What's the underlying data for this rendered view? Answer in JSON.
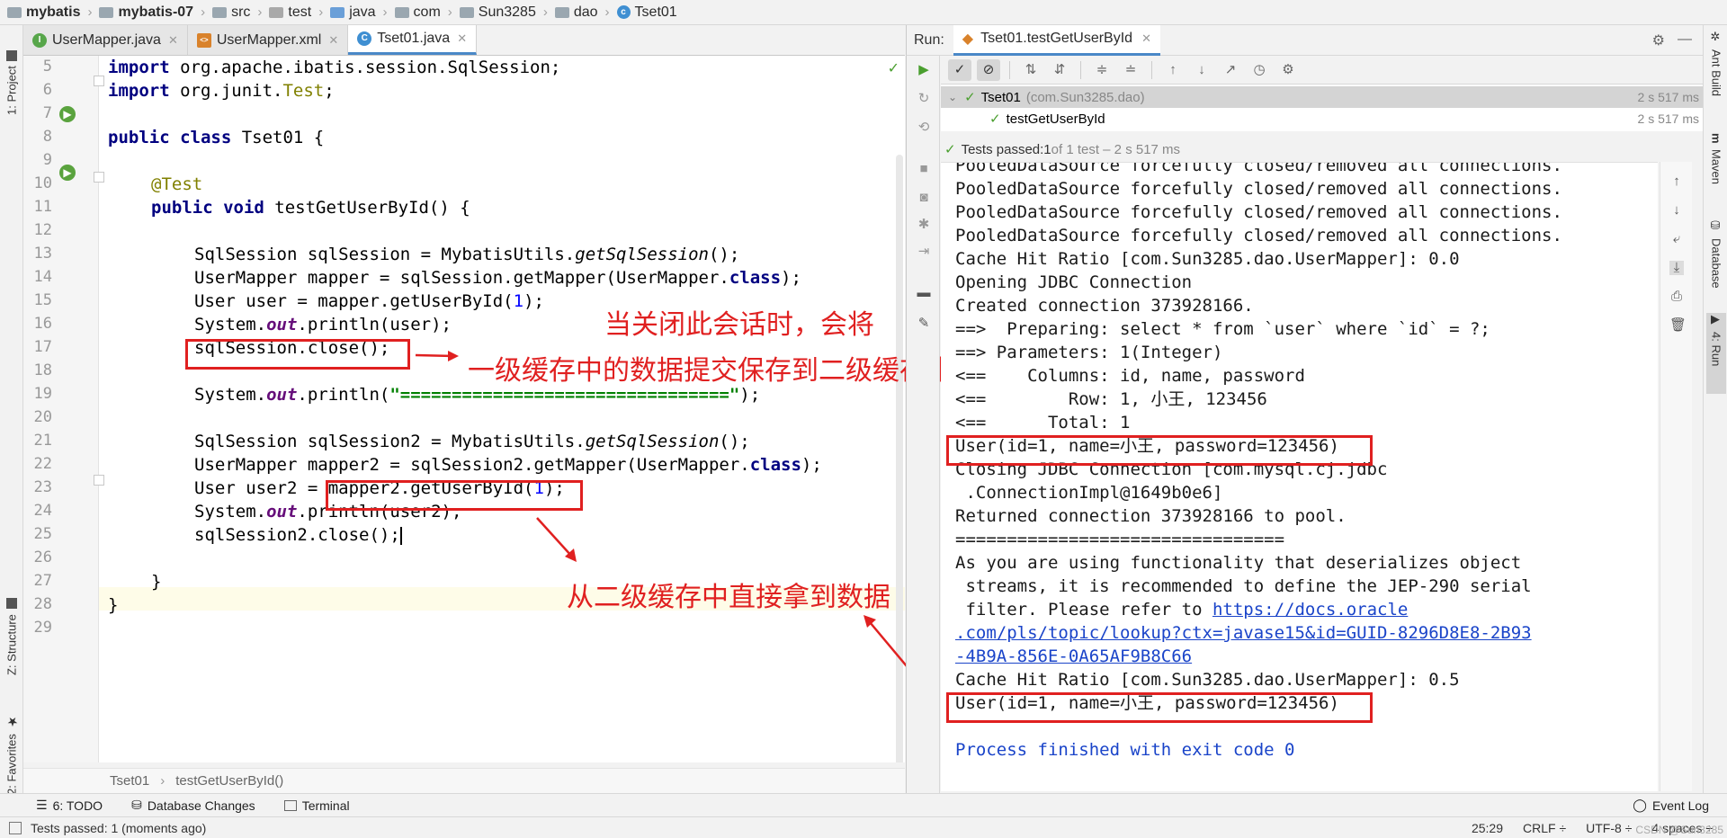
{
  "breadcrumb": [
    "mybatis",
    "mybatis-07",
    "src",
    "test",
    "java",
    "com",
    "Sun3285",
    "dao",
    "Tset01"
  ],
  "left_stripe": {
    "project": "1: Project",
    "structure": "Z: Structure",
    "favorites": "2: Favorites"
  },
  "editor_tabs": [
    {
      "label": "UserMapper.java",
      "icon": "I"
    },
    {
      "label": "UserMapper.xml",
      "icon": "<>"
    },
    {
      "label": "Tset01.java",
      "icon": "C"
    }
  ],
  "code": {
    "line_numbers": [
      "5",
      "6",
      "7",
      "8",
      "9",
      "10",
      "11",
      "12",
      "13",
      "14",
      "15",
      "16",
      "17",
      "18",
      "19",
      "20",
      "21",
      "22",
      "23",
      "24",
      "25",
      "26",
      "27",
      "28",
      "29"
    ],
    "l5": {
      "kw": "import",
      "rest": " org.apache.ibatis.session.SqlSession;"
    },
    "l6": {
      "kw": "import",
      "a": " org.junit.",
      "cls": "Test",
      "b": ";"
    },
    "l8": {
      "kw1": "public",
      "kw2": "class",
      "name": " Tset01 {"
    },
    "l10": {
      "ann": "@Test"
    },
    "l11": {
      "kw1": "public",
      "kw2": "void",
      "rest": " testGetUserById() {"
    },
    "l13": {
      "a": "SqlSession sqlSession = MybatisUtils.",
      "m": "getSqlSession",
      "b": "();"
    },
    "l14": {
      "a": "UserMapper mapper = sqlSession.getMapper(UserMapper.",
      "kw": "class",
      "b": ");"
    },
    "l15": {
      "a": "User user = mapper.getUserById(",
      "n": "1",
      "b": ");"
    },
    "l16": {
      "a": "System.",
      "f": "out",
      "b": ".println(user);"
    },
    "l17": {
      "text": "sqlSession.close();"
    },
    "l19": {
      "a": "System.",
      "f": "out",
      "b": ".println(",
      "s": "\"================================\"",
      "c": ");"
    },
    "l21": {
      "a": "SqlSession sqlSession2 = MybatisUtils.",
      "m": "getSqlSession",
      "b": "();"
    },
    "l22": {
      "a": "UserMapper mapper2 = sqlSession2.getMapper(UserMapper.",
      "kw": "class",
      "b": ");"
    },
    "l23": {
      "a": "User user2 = ",
      "c": "mapper2.getUserById(",
      "n": "1",
      "b": ");"
    },
    "l24": {
      "a": "System.",
      "f": "out",
      "b": ".println(user2);"
    },
    "l25": {
      "text": "sqlSession2.close();"
    },
    "l27": {
      "text": "}"
    },
    "l28": {
      "text": "}"
    }
  },
  "editor_breadcrumb": [
    "Tset01",
    "testGetUserById()"
  ],
  "annotations": {
    "a1": "当关闭此会话时，会将",
    "a2": "一级缓存中的数据提交保存到二级缓存中",
    "a3": "从二级缓存中直接拿到数据"
  },
  "run": {
    "label": "Run:",
    "tab": "Tset01.testGetUserById",
    "tree": [
      {
        "name": "Tset01",
        "pkg": "(com.Sun3285.dao)",
        "time": "2 s 517 ms"
      },
      {
        "name": "testGetUserById",
        "time": "2 s 517 ms"
      }
    ],
    "passed": {
      "a": "Tests passed: ",
      "b": "1",
      "c": " of 1 test – 2 s 517 ms"
    }
  },
  "console": [
    "PooledDataSource forcefully closed/removed all connections.",
    "PooledDataSource forcefully closed/removed all connections.",
    "PooledDataSource forcefully closed/removed all connections.",
    "PooledDataSource forcefully closed/removed all connections.",
    "Cache Hit Ratio [com.Sun3285.dao.UserMapper]: 0.0",
    "Opening JDBC Connection",
    "Created connection 373928166.",
    "==>  Preparing: select * from `user` where `id` = ?;",
    "==> Parameters: 1(Integer)",
    "<==    Columns: id, name, password",
    "<==        Row: 1, 小王, 123456",
    "<==      Total: 1",
    "User(id=1, name=小王, password=123456)",
    "Closing JDBC Connection [com.mysql.cj.jdbc",
    " .ConnectionImpl@1649b0e6]",
    "Returned connection 373928166 to pool.",
    "================================",
    "As you are using functionality that deserializes object",
    " streams, it is recommended to define the JEP-290 serial",
    " filter. Please refer to ",
    "https://docs.oracle",
    ".com/pls/topic/lookup?ctx=javase15&id=GUID-8296D8E8-2B93",
    "-4B9A-856E-0A65AF9B8C66",
    "Cache Hit Ratio [com.Sun3285.dao.UserMapper]: 0.5",
    "User(id=1, name=小王, password=123456)",
    "",
    "Process finished with exit code 0"
  ],
  "right_stripe": {
    "ant": "Ant Build",
    "maven": "Maven",
    "database": "Database",
    "run": "4: Run"
  },
  "tool_bar": {
    "todo": "6: TODO",
    "db_changes": "Database Changes",
    "terminal": "Terminal",
    "event_log": "Event Log"
  },
  "status": {
    "message": "Tests passed: 1 (moments ago)",
    "position": "25:29",
    "line_sep": "CRLF ÷",
    "encoding": "UTF-8 ÷",
    "indent": "4 spaces ÷"
  },
  "watermark": "CSDN @Sun3285",
  "colors": {
    "annotation_red": "#e02020",
    "keyword": "#000080",
    "string": "#008000",
    "number": "#0000ff",
    "link": "#1a44c9"
  }
}
